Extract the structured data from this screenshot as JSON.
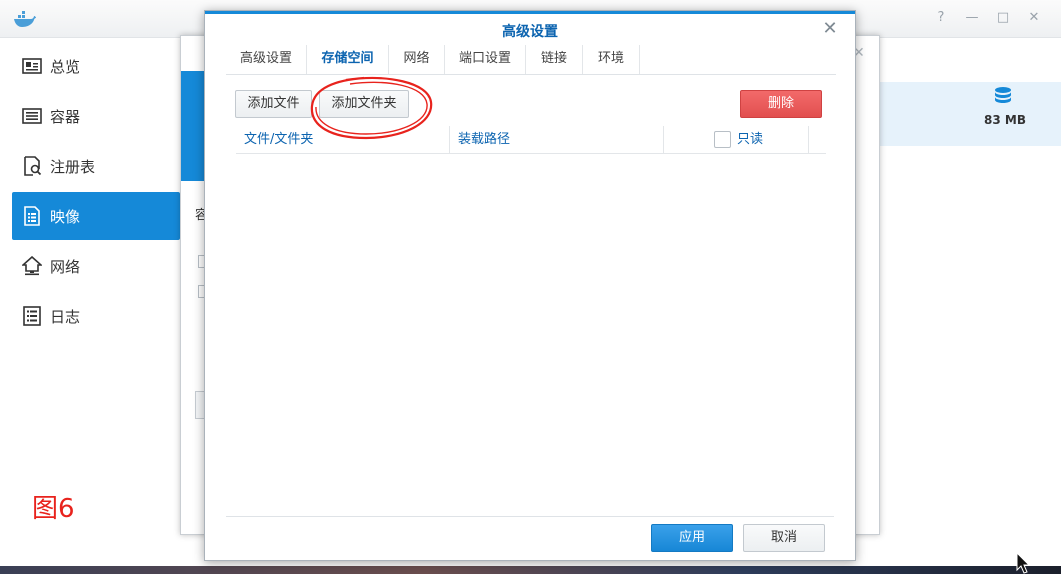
{
  "app": {
    "window_controls": {
      "help": "?",
      "minimize": "—",
      "maximize": "□",
      "close": "✕"
    },
    "sidebar": {
      "items": [
        {
          "label": "总览",
          "icon": "overview-icon"
        },
        {
          "label": "容器",
          "icon": "container-icon"
        },
        {
          "label": "注册表",
          "icon": "registry-icon"
        },
        {
          "label": "映像",
          "icon": "image-icon",
          "active": true
        },
        {
          "label": "网络",
          "icon": "network-icon"
        },
        {
          "label": "日志",
          "icon": "log-icon"
        }
      ]
    },
    "storage_size": "83 MB",
    "bg_dialog": {
      "partial_text": "容",
      "close": "✕"
    }
  },
  "dialog": {
    "title": "高级设置",
    "close": "✕",
    "tabs": [
      {
        "label": "高级设置"
      },
      {
        "label": "存储空间",
        "active": true
      },
      {
        "label": "网络"
      },
      {
        "label": "端口设置"
      },
      {
        "label": "链接"
      },
      {
        "label": "环境"
      }
    ],
    "toolbar": {
      "add_file": "添加文件",
      "add_folder": "添加文件夹",
      "delete": "删除"
    },
    "table": {
      "columns": {
        "path": "文件/文件夹",
        "mount_path": "装载路径",
        "readonly": "只读"
      },
      "rows": []
    },
    "footer": {
      "apply": "应用",
      "cancel": "取消"
    }
  },
  "annotation": {
    "label": "图6",
    "color": "#e8231d"
  },
  "colors": {
    "accent": "#1589d8",
    "danger": "#e24f4f",
    "title": "#0c64b0"
  }
}
